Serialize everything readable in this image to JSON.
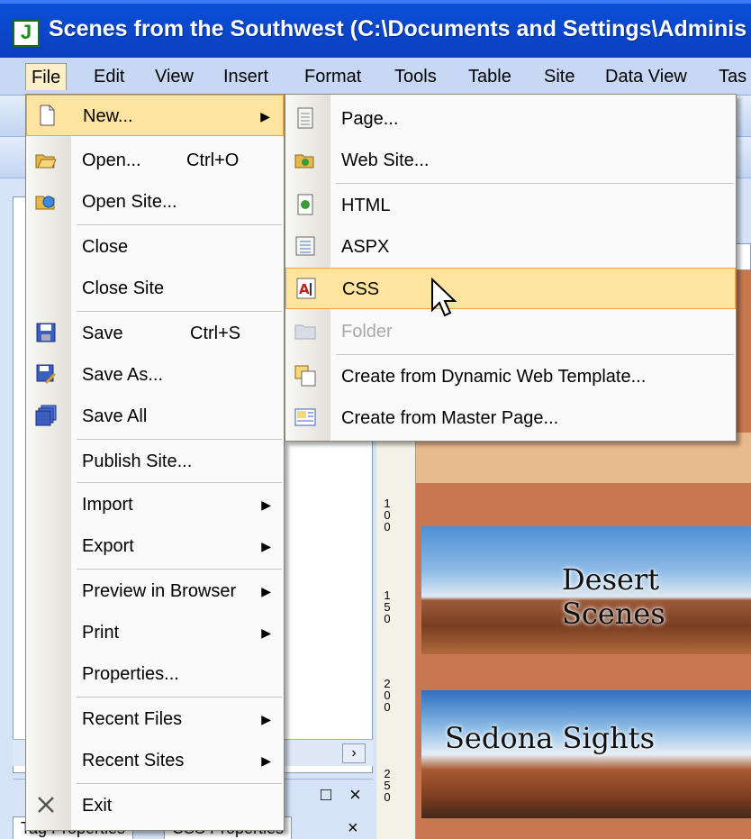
{
  "window": {
    "title": "Scenes from the Southwest (C:\\Documents and Settings\\Adminis"
  },
  "menubar": {
    "items": [
      "File",
      "Edit",
      "View",
      "Insert",
      "Format",
      "Tools",
      "Table",
      "Site",
      "Data View",
      "Tas"
    ]
  },
  "file_menu": {
    "items": [
      {
        "label": "New...",
        "shortcut": "",
        "submenu": true,
        "highlighted": true,
        "icon": "new-page-icon"
      },
      {
        "label": "Open...",
        "shortcut": "Ctrl+O",
        "icon": "open-folder-icon"
      },
      {
        "label": "Open Site...",
        "shortcut": "",
        "icon": "open-site-icon"
      },
      {
        "label": "Close",
        "shortcut": ""
      },
      {
        "label": "Close Site",
        "shortcut": ""
      },
      {
        "label": "Save",
        "shortcut": "Ctrl+S",
        "icon": "save-icon"
      },
      {
        "label": "Save As...",
        "shortcut": "",
        "icon": "save-as-icon"
      },
      {
        "label": "Save All",
        "shortcut": "",
        "icon": "save-all-icon"
      },
      {
        "label": "Publish Site...",
        "shortcut": ""
      },
      {
        "label": "Import",
        "submenu": true
      },
      {
        "label": "Export",
        "submenu": true
      },
      {
        "label": "Preview in Browser",
        "submenu": true
      },
      {
        "label": "Print",
        "submenu": true
      },
      {
        "label": "Properties...",
        "shortcut": ""
      },
      {
        "label": "Recent Files",
        "submenu": true
      },
      {
        "label": "Recent Sites",
        "submenu": true
      },
      {
        "label": "Exit",
        "shortcut": "",
        "icon": "exit-icon"
      }
    ]
  },
  "new_submenu": {
    "items": [
      {
        "label": "Page...",
        "icon": "page-icon"
      },
      {
        "label": "Web Site...",
        "icon": "web-site-icon"
      },
      {
        "label": "HTML",
        "icon": "html-icon"
      },
      {
        "label": "ASPX",
        "icon": "aspx-icon"
      },
      {
        "label": "CSS",
        "icon": "css-icon",
        "highlighted": true
      },
      {
        "label": "Folder",
        "icon": "folder-icon",
        "disabled": true
      },
      {
        "label": "Create from Dynamic Web Template...",
        "icon": "dwt-icon"
      },
      {
        "label": "Create from Master Page...",
        "icon": "master-page-icon"
      }
    ]
  },
  "panel": {
    "tabs": [
      "Tag Properties",
      "CSS Properties"
    ]
  },
  "ruler": {
    "labels": [
      "100",
      "150",
      "200",
      "250"
    ]
  },
  "design": {
    "banner1": "Desert Scenes",
    "banner2": "Sedona Sights"
  },
  "colors": {
    "menu_highlight": "#ffe4a0",
    "titlebar": "#0a4fd6",
    "design_bg": "#c8784f"
  }
}
